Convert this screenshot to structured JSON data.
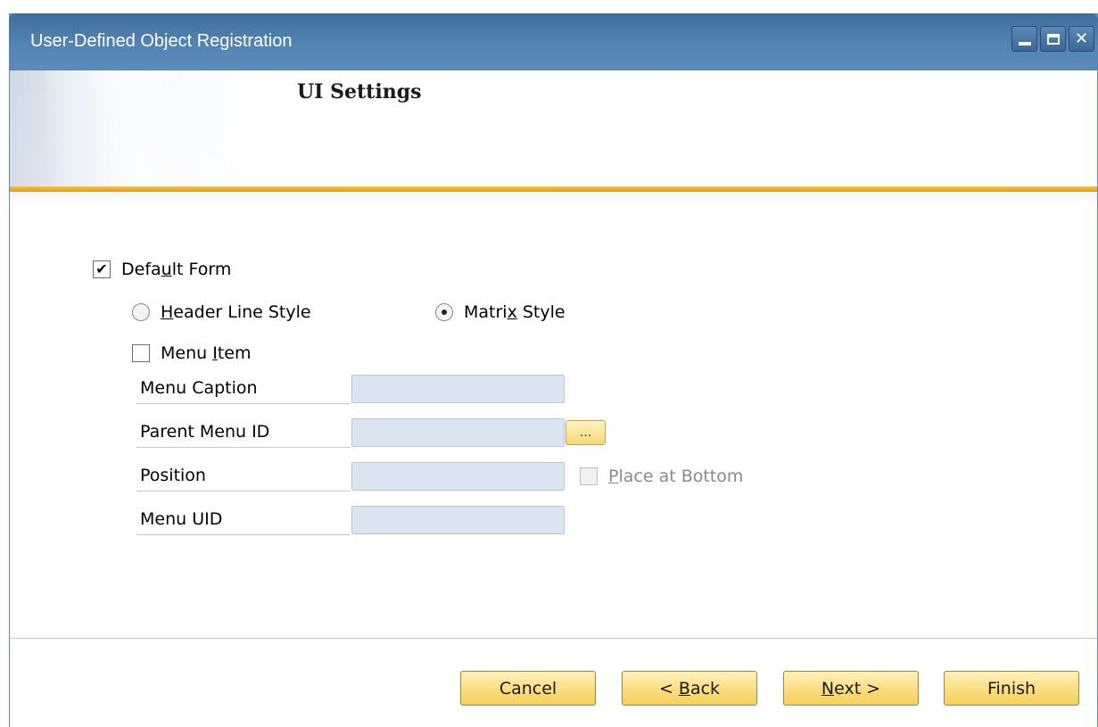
{
  "window": {
    "title": "User-Defined Object Registration"
  },
  "banner": {
    "title": "UI Settings"
  },
  "form": {
    "default_form": {
      "label_pre": "Defa",
      "label_u": "u",
      "label_post": "lt Form",
      "checked": true
    },
    "header_line_style": {
      "label_u": "H",
      "label_post": "eader Line Style",
      "selected": false
    },
    "matrix_style": {
      "label_pre": "Matri",
      "label_u": "x",
      "label_post": " Style",
      "selected": true
    },
    "menu_item": {
      "label_pre": "Menu ",
      "label_u": "I",
      "label_post": "tem",
      "checked": false
    },
    "fields": {
      "menu_caption": {
        "label": "Menu Caption",
        "value": ""
      },
      "parent_menu_id": {
        "label": "Parent Menu ID",
        "value": "",
        "browse_label": "..."
      },
      "position": {
        "label": "Position",
        "value": ""
      },
      "menu_uid": {
        "label": "Menu UID",
        "value": ""
      }
    },
    "place_at_bottom": {
      "label_u": "P",
      "label_post": "lace at Bottom",
      "checked": false,
      "enabled": false
    }
  },
  "buttons": {
    "cancel": "Cancel",
    "back_pre": "< ",
    "back_u": "B",
    "back_post": "ack",
    "next_u": "N",
    "next_post": "ext >",
    "finish": "Finish"
  },
  "colors": {
    "accent_gold": "#e49a10",
    "title_bar": "#4a7aab",
    "input_bg": "#dbe5f1"
  }
}
